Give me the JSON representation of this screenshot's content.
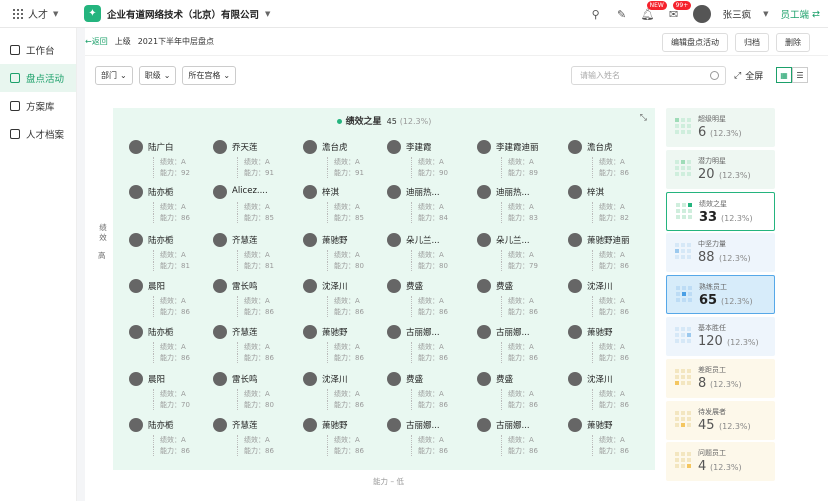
{
  "topbar": {
    "app_name": "人才",
    "company": "企业有道网络技术（北京）有限公司",
    "badge_new": "NEW",
    "badge_count": "99+",
    "user_name": "张三疯",
    "emp_btn": "员工端"
  },
  "sidebar": {
    "items": [
      {
        "label": "工作台",
        "icon": "desktop-icon"
      },
      {
        "label": "盘点活动",
        "icon": "flag-icon"
      },
      {
        "label": "方案库",
        "icon": "layers-icon"
      },
      {
        "label": "人才档案",
        "icon": "profile-icon"
      }
    ]
  },
  "crumb": {
    "back": "←返回",
    "up": "上级",
    "title": "2021下半年中层盘点",
    "edit": "编辑盘点活动",
    "archive": "归档",
    "delete": "删除"
  },
  "filters": {
    "dept": "部门",
    "level": "职级",
    "post": "所在宫格",
    "search_placeholder": "请输入姓名",
    "fullscreen": "全屏"
  },
  "axis": {
    "y_1": "绩效",
    "y_2": "高",
    "x": "能力 – 低"
  },
  "panel": {
    "title": "绩效之星",
    "count": "45",
    "pct": "(12.3%)"
  },
  "people": [
    {
      "name": "陆广白",
      "perf": "绩效：A",
      "ability": "能力：92"
    },
    {
      "name": "乔天莲",
      "perf": "绩效：A",
      "ability": "能力：91"
    },
    {
      "name": "澹台虎",
      "perf": "绩效：A",
      "ability": "能力：91"
    },
    {
      "name": "李建霞",
      "perf": "绩效：A",
      "ability": "能力：90"
    },
    {
      "name": "李建霞迪丽",
      "perf": "绩效：A",
      "ability": "能力：89"
    },
    {
      "name": "澹台虎",
      "perf": "绩效：A",
      "ability": "能力：86"
    },
    {
      "name": "陆亦栀",
      "perf": "绩效：A",
      "ability": "能力：86"
    },
    {
      "name": "Alicez....",
      "perf": "绩效：A",
      "ability": "能力：85"
    },
    {
      "name": "梓淇",
      "perf": "绩效：A",
      "ability": "能力：85"
    },
    {
      "name": "迪丽热...",
      "perf": "绩效：A",
      "ability": "能力：84"
    },
    {
      "name": "迪丽热...",
      "perf": "绩效：A",
      "ability": "能力：83"
    },
    {
      "name": "梓淇",
      "perf": "绩效：A",
      "ability": "能力：82"
    },
    {
      "name": "陆亦栀",
      "perf": "绩效：A",
      "ability": "能力：81"
    },
    {
      "name": "齐慧莲",
      "perf": "绩效：A",
      "ability": "能力：81"
    },
    {
      "name": "萧驰野",
      "perf": "绩效：A",
      "ability": "能力：80"
    },
    {
      "name": "朵儿兰...",
      "perf": "绩效：A",
      "ability": "能力：80"
    },
    {
      "name": "朵儿兰...",
      "perf": "绩效：A",
      "ability": "能力：79"
    },
    {
      "name": "萧驰野迪丽",
      "perf": "绩效：A",
      "ability": "能力：86"
    },
    {
      "name": "晨阳",
      "perf": "绩效：A",
      "ability": "能力：86"
    },
    {
      "name": "雷长鸣",
      "perf": "绩效：A",
      "ability": "能力：86"
    },
    {
      "name": "沈泽川",
      "perf": "绩效：A",
      "ability": "能力：86"
    },
    {
      "name": "费盛",
      "perf": "绩效：A",
      "ability": "能力：86"
    },
    {
      "name": "费盛",
      "perf": "绩效：A",
      "ability": "能力：86"
    },
    {
      "name": "沈泽川",
      "perf": "绩效：A",
      "ability": "能力：86"
    },
    {
      "name": "陆亦栀",
      "perf": "绩效：A",
      "ability": "能力：86"
    },
    {
      "name": "齐慧莲",
      "perf": "绩效：A",
      "ability": "能力：86"
    },
    {
      "name": "萧驰野",
      "perf": "绩效：A",
      "ability": "能力：86"
    },
    {
      "name": "古丽娜...",
      "perf": "绩效：A",
      "ability": "能力：86"
    },
    {
      "name": "古丽娜...",
      "perf": "绩效：A",
      "ability": "能力：86"
    },
    {
      "name": "萧驰野",
      "perf": "绩效：A",
      "ability": "能力：86"
    },
    {
      "name": "晨阳",
      "perf": "绩效：A",
      "ability": "能力：70"
    },
    {
      "name": "雷长鸣",
      "perf": "绩效：A",
      "ability": "能力：80"
    },
    {
      "name": "沈泽川",
      "perf": "绩效：A",
      "ability": "能力：86"
    },
    {
      "name": "费盛",
      "perf": "绩效：A",
      "ability": "能力：86"
    },
    {
      "name": "费盛",
      "perf": "绩效：A",
      "ability": "能力：86"
    },
    {
      "name": "沈泽川",
      "perf": "绩效：A",
      "ability": "能力：86"
    },
    {
      "name": "陆亦栀",
      "perf": "绩效：A",
      "ability": "能力：86"
    },
    {
      "name": "齐慧莲",
      "perf": "绩效：A",
      "ability": "能力：86"
    },
    {
      "name": "萧驰野",
      "perf": "绩效：A",
      "ability": "能力：86"
    },
    {
      "name": "古丽娜...",
      "perf": "绩效：A",
      "ability": "能力：86"
    },
    {
      "name": "古丽娜...",
      "perf": "绩效：A",
      "ability": "能力：86"
    },
    {
      "name": "萧驰野",
      "perf": "绩效：A",
      "ability": "能力：86"
    }
  ],
  "categories": [
    {
      "name": "超级明星",
      "count": "6",
      "pct": "(12.3%)",
      "style": "green"
    },
    {
      "name": "潜力明星",
      "count": "20",
      "pct": "(12.3%)",
      "style": "green"
    },
    {
      "name": "绩效之星",
      "count": "33",
      "pct": "(12.3%)",
      "style": "sel-green"
    },
    {
      "name": "中坚力量",
      "count": "88",
      "pct": "(12.3%)",
      "style": "blue"
    },
    {
      "name": "熟练员工",
      "count": "65",
      "pct": "(12.3%)",
      "style": "sel-blue"
    },
    {
      "name": "基本胜任",
      "count": "120",
      "pct": "(12.3%)",
      "style": "blue"
    },
    {
      "name": "差距员工",
      "count": "8",
      "pct": "(12.3%)",
      "style": "yellow"
    },
    {
      "name": "待发展者",
      "count": "45",
      "pct": "(12.3%)",
      "style": "yellow"
    },
    {
      "name": "问题员工",
      "count": "4",
      "pct": "(12.3%)",
      "style": "yellow"
    }
  ]
}
